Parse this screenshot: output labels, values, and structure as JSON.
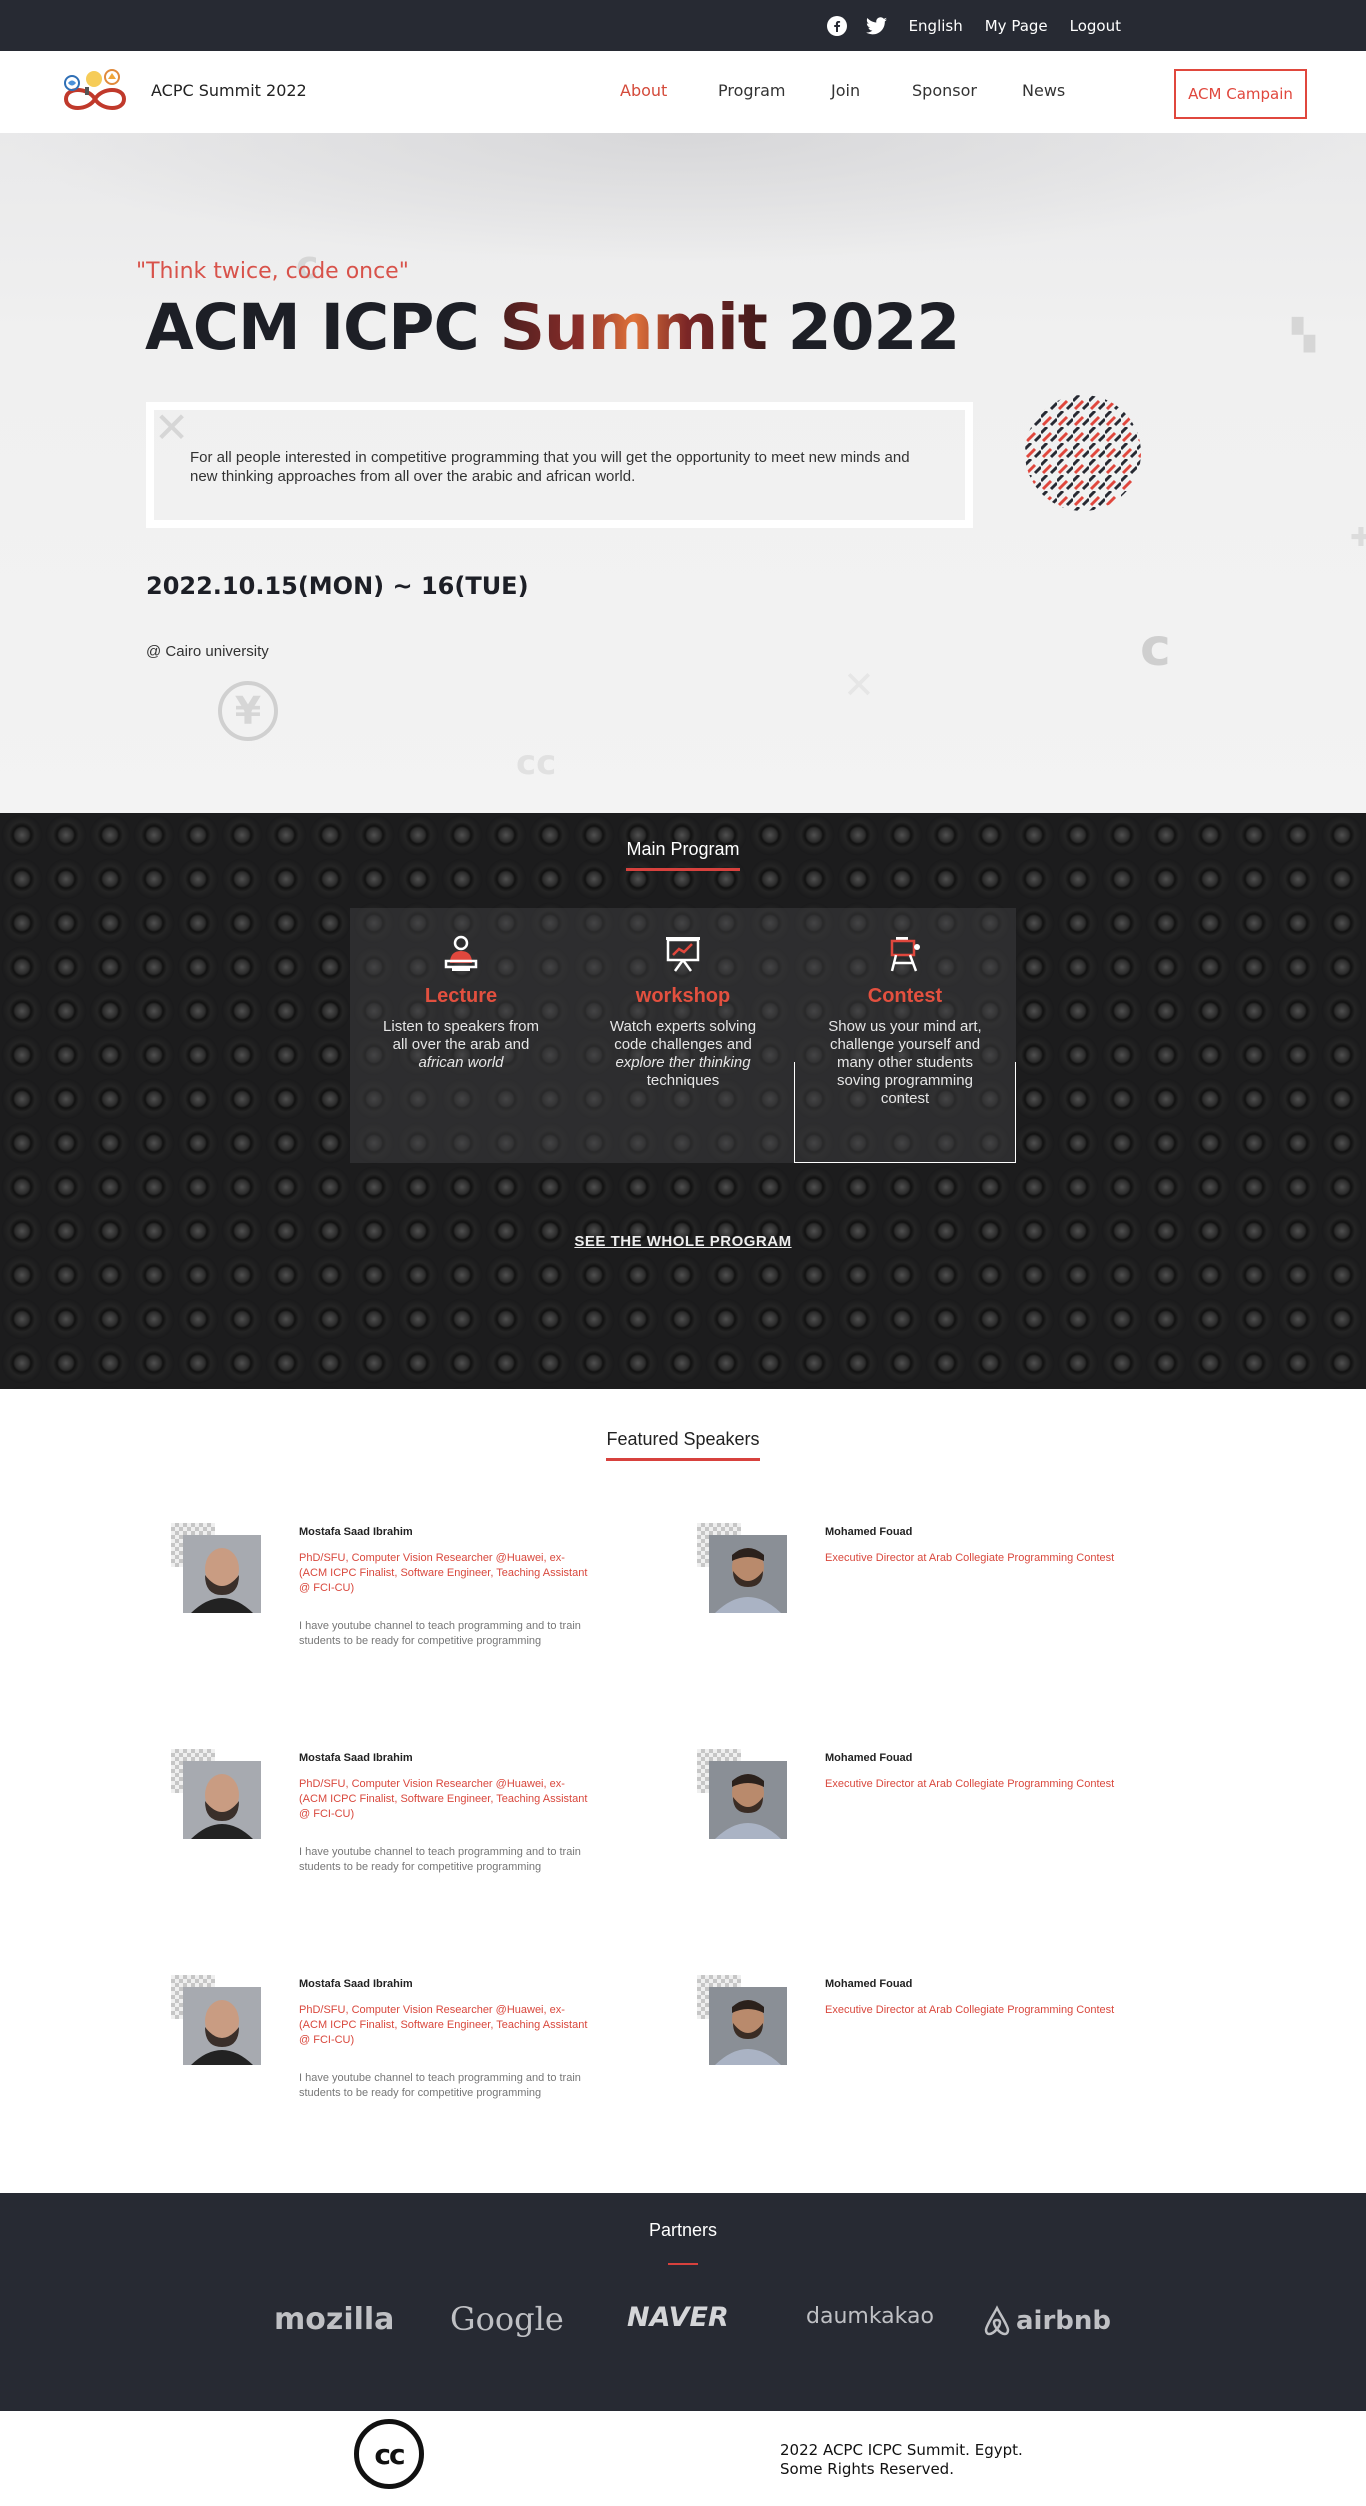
{
  "topbar": {
    "icons": [
      "facebook-icon",
      "twitter-icon"
    ],
    "links": [
      "English",
      "My Page",
      "Logout"
    ]
  },
  "nav": {
    "brand": "ACPC Summit 2022",
    "menu": [
      "About",
      "Program",
      "Join",
      "Sponsor",
      "News"
    ],
    "active": "About",
    "campaign": "ACM Campain"
  },
  "hero": {
    "quote": "\"Think twice, code once\"",
    "title_a": "ACM ICPC ",
    "title_b": "Summit",
    "title_c": " 2022",
    "description": "For all people interested in competitive programming that you will get the opportunity to meet new minds and new thinking approaches from all over the arabic and african world.",
    "date": "2022.10.15(MON) ~ 16(TUE)",
    "venue": "@ Cairo university"
  },
  "program": {
    "title": "Main Program",
    "cards": [
      {
        "icon": "lecturer-icon",
        "title": "Lecture",
        "text": "Listen to speakers from all over the arab and ",
        "em": "african world",
        "text2": ""
      },
      {
        "icon": "presentation-icon",
        "title": "workshop",
        "text": "Watch experts solving code challenges and ",
        "em": "explore ther thinking",
        "text2": " techniques"
      },
      {
        "icon": "easel-icon",
        "title": "Contest",
        "text": "Show us your mind art, challenge yourself and many other students soving programming contest",
        "em": "",
        "text2": ""
      }
    ],
    "link": "SEE THE WHOLE PROGRAM"
  },
  "speakers": {
    "title": "Featured Speakers",
    "items": [
      {
        "name": "Mostafa Saad Ibrahim",
        "role": "PhD/SFU, Computer Vision Researcher @Huawei, ex-(ACM ICPC Finalist, Software Engineer, Teaching Assistant @ FCI-CU)",
        "bio": "I have youtube channel to teach programming and to train students to be ready for competitive programming"
      },
      {
        "name": "Mohamed Fouad",
        "role": "Executive Director at Arab Collegiate Programming Contest",
        "bio": ""
      },
      {
        "name": "Mostafa Saad Ibrahim",
        "role": "PhD/SFU, Computer Vision Researcher @Huawei, ex-(ACM ICPC Finalist, Software Engineer, Teaching Assistant @ FCI-CU)",
        "bio": "I have youtube channel to teach programming and to train students to be ready for competitive programming"
      },
      {
        "name": "Mohamed Fouad",
        "role": "Executive Director at Arab Collegiate Programming Contest",
        "bio": ""
      },
      {
        "name": "Mostafa Saad Ibrahim",
        "role": "PhD/SFU, Computer Vision Researcher @Huawei, ex-(ACM ICPC Finalist, Software Engineer, Teaching Assistant @ FCI-CU)",
        "bio": "I have youtube channel to teach programming and to train students to be ready for competitive programming"
      },
      {
        "name": "Mohamed Fouad",
        "role": "Executive Director at Arab Collegiate Programming Contest",
        "bio": ""
      }
    ]
  },
  "partners": {
    "title": "Partners",
    "logos": [
      "mozilla",
      "Google",
      "NAVER",
      "daumkakao",
      "airbnb"
    ]
  },
  "footer": {
    "cc": "cc",
    "line1": "2022 ACPC ICPC Summit. Egypt.",
    "line2": "Some Rights Reserved."
  }
}
